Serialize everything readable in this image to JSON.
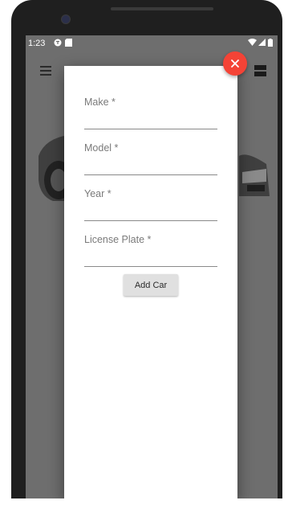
{
  "statusbar": {
    "time": "1:23"
  },
  "form": {
    "fields": [
      {
        "label": "Make *",
        "value": ""
      },
      {
        "label": "Model *",
        "value": ""
      },
      {
        "label": "Year *",
        "value": ""
      },
      {
        "label": "License Plate *",
        "value": ""
      }
    ],
    "submit_label": "Add Car"
  },
  "icons": {
    "menu": "menu-icon",
    "close": "close-icon",
    "view": "view-agenda-icon"
  },
  "colors": {
    "close_button": "#f44336",
    "add_button": "#e0e0e0",
    "scrim": "#6e6e6e"
  }
}
